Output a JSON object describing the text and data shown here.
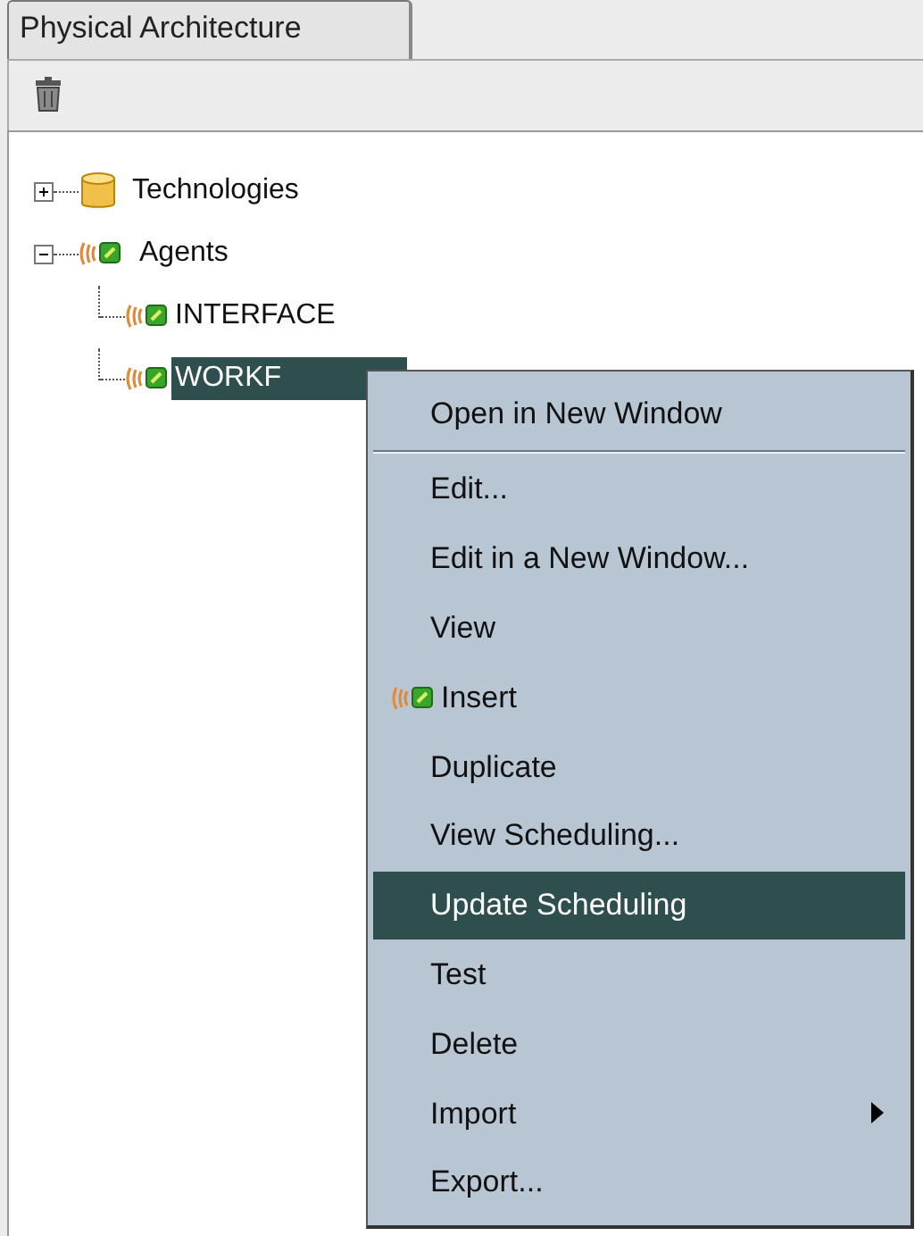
{
  "panel": {
    "title": "Physical Architecture"
  },
  "toolbar": {
    "buttons": [
      {
        "kind": "delete"
      }
    ]
  },
  "tree": [
    {
      "label": "Technologies",
      "kind": "database",
      "expanded": false,
      "selected": false
    },
    {
      "label": "Agents",
      "kind": "agent",
      "expanded": true,
      "selected": false,
      "children": [
        {
          "label": "INTERFACE",
          "kind": "agent",
          "selected": false
        },
        {
          "label": "WORKF",
          "kind": "agent",
          "selected": true
        }
      ]
    }
  ],
  "context_menu": {
    "items": [
      {
        "label": "Open in New Window",
        "selected": false,
        "separator_after": true
      },
      {
        "label": "Edit...",
        "selected": false
      },
      {
        "label": "Edit in a New Window...",
        "selected": false
      },
      {
        "label": "View",
        "selected": false
      },
      {
        "label": "Insert",
        "selected": false,
        "kind": "agent"
      },
      {
        "label": "Duplicate",
        "selected": false
      },
      {
        "label": "View Scheduling...",
        "selected": false
      },
      {
        "label": "Update Scheduling",
        "selected": true
      },
      {
        "label": "Test",
        "selected": false
      },
      {
        "label": "Delete",
        "selected": false
      },
      {
        "label": "Import",
        "selected": false,
        "submenu": true
      },
      {
        "label": "Export...",
        "selected": false
      }
    ]
  }
}
